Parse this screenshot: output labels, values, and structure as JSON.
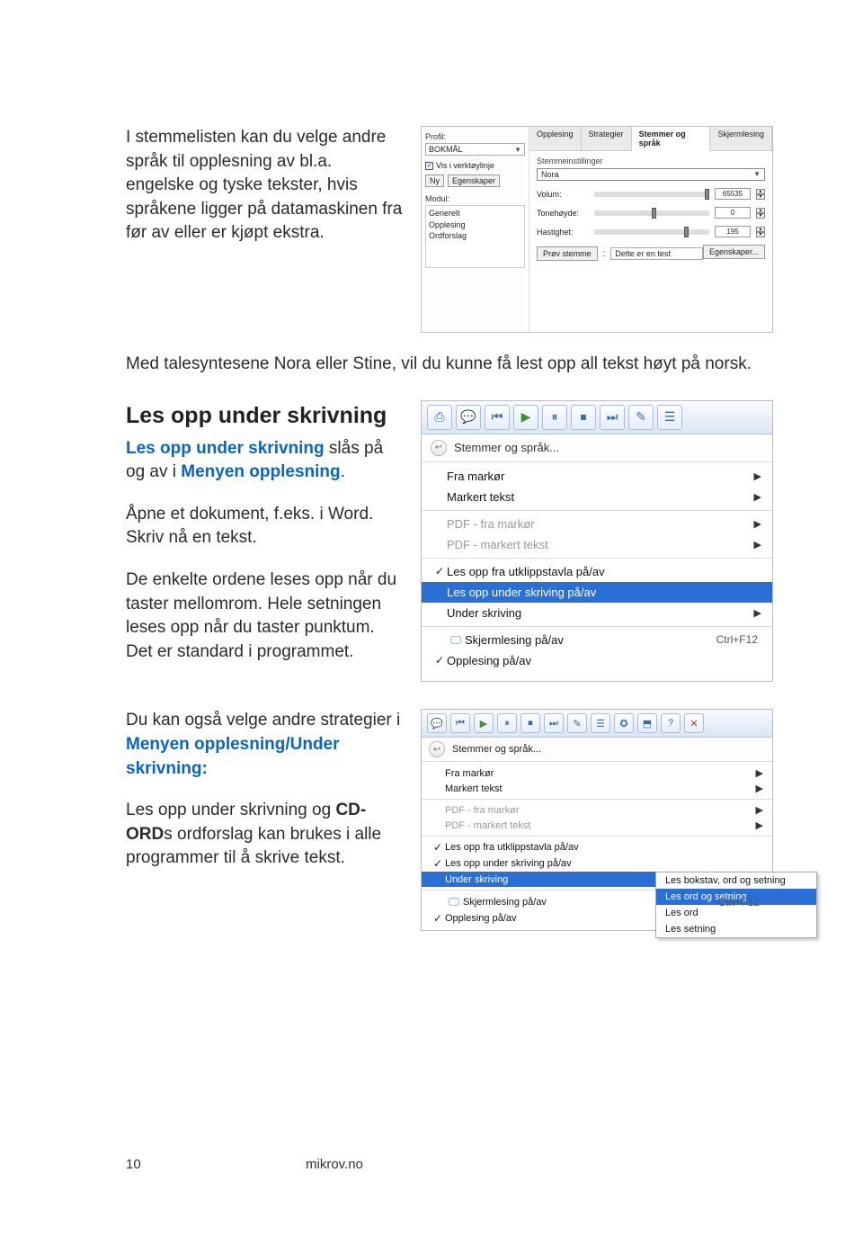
{
  "para1": "I stemmelisten kan du velge andre språk til opplesning av bl.a. engelske og tyske tekster, hvis språkene ligger på datamaskinen fra før av eller er kjøpt ekstra.",
  "para2": "Med talesyntesene Nora eller Stine, vil du kunne få lest opp all tekst høyt på norsk.",
  "h2": "Les opp under skrivning",
  "para3a": "Les opp under skrivning",
  "para3b": " slås på og av i ",
  "para3c": "Menyen opplesning",
  "para3d": ".",
  "para4": "Åpne et dokument, f.eks. i Word. Skriv nå en tekst.",
  "para5": "De enkelte ordene leses opp når du taster mellomrom. Hele setningen leses opp når du taster punktum. Det er standard i programmet.",
  "para6a": "Du kan også velge andre strategier i ",
  "para6b": "Menyen opp­lesning/Under skrivning:",
  "para7a": "Les opp under skrivning og ",
  "para7b": "CD-ORD",
  "para7c": "s ordforslag kan brukes i alle programmer til å skrive tekst.",
  "settings": {
    "profil": "Profil:",
    "profilVal": "BOKMÅL",
    "visVerktoy": "Vis i verktøylinje",
    "ny": "Ny",
    "egenskaper": "Egenskaper",
    "modul": "Modul:",
    "mod1": "Generelt",
    "mod2": "Opplesing",
    "mod3": "Ordforslag",
    "tabs": [
      "Opplesing",
      "Strategier",
      "Stemmer og språk",
      "Skjermlesing"
    ],
    "grp": "Stemmeinstillinger",
    "voice": "Nora",
    "volum": "Volum:",
    "volumVal": "65535",
    "tone": "Tonehøyde:",
    "toneVal": "0",
    "hast": "Hastighet:",
    "hastVal": "195",
    "egenskBtn": "Egenskaper...",
    "test": "Prøv stemme",
    "testText": "Dette er en test"
  },
  "menu": {
    "title": "Stemmer og språk...",
    "items": [
      {
        "label": "Fra markør",
        "arrow": true
      },
      {
        "label": "Markert tekst",
        "arrow": true
      },
      {
        "label": "PDF - fra markør",
        "arrow": true,
        "disabled": true
      },
      {
        "label": "PDF - markert tekst",
        "arrow": true,
        "disabled": true
      },
      {
        "label": "Les opp fra utklippstavla på/av",
        "check": true
      },
      {
        "label": "Les opp under skriving på/av",
        "sel": true
      },
      {
        "label": "Under skriving",
        "arrow": true
      },
      {
        "label": "Skjermlesing på/av",
        "shortcut": "Ctrl+F12",
        "icon": true
      },
      {
        "label": "Opplesing på/av",
        "check": true
      }
    ]
  },
  "menu2": {
    "title": "Stemmer og språk...",
    "items": [
      {
        "label": "Fra markør",
        "arrow": true
      },
      {
        "label": "Markert tekst",
        "arrow": true
      },
      {
        "label": "PDF - fra markør",
        "arrow": true,
        "disabled": true
      },
      {
        "label": "PDF - markert tekst",
        "arrow": true,
        "disabled": true
      },
      {
        "label": "Les opp fra utklippstavla på/av",
        "check": true
      },
      {
        "label": "Les opp under skriving på/av",
        "check": true
      },
      {
        "label": "Under skriving",
        "arrow": true,
        "sel": true
      },
      {
        "label": "Skjermlesing på/av",
        "shortcut": "Ctrl+F12",
        "icon": true
      },
      {
        "label": "Opplesing på/av",
        "check": true
      }
    ],
    "submenu": [
      "Les bokstav, ord og setning",
      "Les ord og setning",
      "Les ord",
      "Les setning"
    ]
  },
  "footer": {
    "page": "10",
    "site": "mikrov.no"
  }
}
